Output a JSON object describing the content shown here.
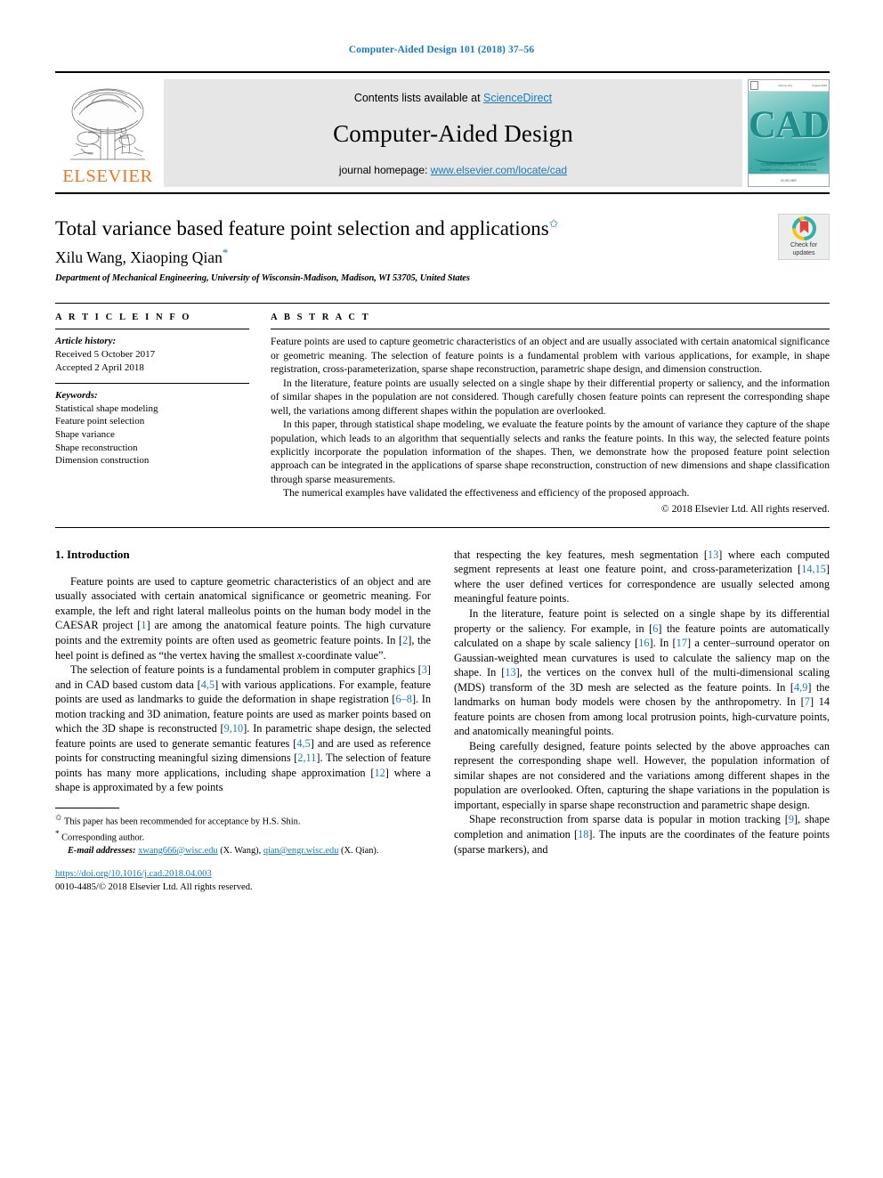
{
  "running_head": "Computer-Aided Design 101 (2018) 37–56",
  "masthead": {
    "publisher_name": "ELSEVIER",
    "contents_prefix": "Contents lists available at ",
    "contents_link": "ScienceDirect",
    "journal_name": "Computer-Aided Design",
    "homepage_prefix": "journal homepage: ",
    "homepage_link": "www.elsevier.com/locate/cad",
    "cover": {
      "letters": "CAD",
      "subtitle": "COMPUTER-AIDED DESIGN",
      "top_left": "Volume 101",
      "top_right": "August 2018",
      "bottom": "ELSEVIER",
      "bottom_note": "Available online at www.sciencedirect.com"
    }
  },
  "article": {
    "title": "Total variance based feature point selection and applications",
    "title_marker": "✩",
    "authors": "Xilu Wang, Xiaoping Qian",
    "author_marker": "*",
    "affiliation": "Department of Mechanical Engineering, University of Wisconsin-Madison, Madison, WI 53705, United States",
    "crossmark_label_line1": "Check for",
    "crossmark_label_line2": "updates"
  },
  "info": {
    "heading": "A R T I C L E   I N F O",
    "history_label": "Article history:",
    "history": [
      "Received 5 October 2017",
      "Accepted 2 April 2018"
    ],
    "keywords_label": "Keywords:",
    "keywords": [
      "Statistical shape modeling",
      "Feature point selection",
      "Shape variance",
      "Shape reconstruction",
      "Dimension construction"
    ]
  },
  "abstract": {
    "heading": "A B S T R A C T",
    "paragraphs": [
      "Feature points are used to capture geometric characteristics of an object and are usually associated with certain anatomical significance or geometric meaning. The selection of feature points is a fundamental problem with various applications, for example, in shape registration, cross-parameterization, sparse shape reconstruction, parametric shape design, and dimension construction.",
      "In the literature, feature points are usually selected on a single shape by their differential property or saliency, and the information of similar shapes in the population are not considered. Though carefully chosen feature points can represent the corresponding shape well, the variations among different shapes within the population are overlooked.",
      "In this paper, through statistical shape modeling, we evaluate the feature points by the amount of variance they capture of the shape population, which leads to an algorithm that sequentially selects and ranks the feature points. In this way, the selected feature points explicitly incorporate the population information of the shapes. Then, we demonstrate how the proposed feature point selection approach can be integrated in the applications of sparse shape reconstruction, construction of new dimensions and shape classification through sparse measurements.",
      "The numerical examples have validated the effectiveness and efficiency of the proposed approach."
    ],
    "copyright": "© 2018 Elsevier Ltd. All rights reserved."
  },
  "body": {
    "section_heading": "1. Introduction",
    "left_column": [
      {
        "indent": true,
        "runs": [
          {
            "t": "Feature points are used to capture geometric characteristics of an object and are usually associated with certain anatomical significance or geometric meaning. For example, the left and right lateral malleolus points on the human body model in the CAESAR project ["
          },
          {
            "t": "1",
            "ref": true
          },
          {
            "t": "] are among the anatomical feature points. The high curvature points and the extremity points are often used as geometric feature points. In ["
          },
          {
            "t": "2",
            "ref": true
          },
          {
            "t": "], the heel point is defined as “the vertex having the smallest "
          },
          {
            "t": "x",
            "ital": true
          },
          {
            "t": "-coordinate value”."
          }
        ]
      },
      {
        "indent": true,
        "runs": [
          {
            "t": "The selection of feature points is a fundamental problem in computer graphics ["
          },
          {
            "t": "3",
            "ref": true
          },
          {
            "t": "] and in CAD based custom data ["
          },
          {
            "t": "4,5",
            "ref": true
          },
          {
            "t": "] with various applications. For example, feature points are used as landmarks to guide the deformation in shape registration ["
          },
          {
            "t": "6–8",
            "ref": true
          },
          {
            "t": "]. In motion tracking and 3D animation, feature points are used as marker points based on which the 3D shape is reconstructed ["
          },
          {
            "t": "9,10",
            "ref": true
          },
          {
            "t": "]. In parametric shape design, the selected feature points are used to generate semantic features ["
          },
          {
            "t": "4,5",
            "ref": true
          },
          {
            "t": "] and are used as reference points for constructing meaningful sizing dimensions ["
          },
          {
            "t": "2,11",
            "ref": true
          },
          {
            "t": "]. The selection of feature points has many more applications, including shape approximation ["
          },
          {
            "t": "12",
            "ref": true
          },
          {
            "t": "] where a shape is approximated by a few points"
          }
        ]
      }
    ],
    "right_column": [
      {
        "indent": false,
        "runs": [
          {
            "t": "that respecting the key features, mesh segmentation ["
          },
          {
            "t": "13",
            "ref": true
          },
          {
            "t": "] where each computed segment represents at least one feature point, and cross-parameterization ["
          },
          {
            "t": "14,15",
            "ref": true
          },
          {
            "t": "] where the user defined vertices for correspondence are usually selected among meaningful feature points."
          }
        ]
      },
      {
        "indent": true,
        "runs": [
          {
            "t": "In the literature, feature point is selected on a single shape by its differential property or the saliency. For example, in ["
          },
          {
            "t": "6",
            "ref": true
          },
          {
            "t": "] the feature points are automatically calculated on a shape by scale saliency ["
          },
          {
            "t": "16",
            "ref": true
          },
          {
            "t": "]. In ["
          },
          {
            "t": "17",
            "ref": true
          },
          {
            "t": "] a center–surround operator on Gaussian-weighted mean curvatures is used to calculate the saliency map on the shape. In ["
          },
          {
            "t": "13",
            "ref": true
          },
          {
            "t": "], the vertices on the convex hull of the multi-dimensional scaling (MDS) transform of the 3D mesh are selected as the feature points. In ["
          },
          {
            "t": "4,9",
            "ref": true
          },
          {
            "t": "] the landmarks on human body models were chosen by the anthropometry. In ["
          },
          {
            "t": "7",
            "ref": true
          },
          {
            "t": "] 14 feature points are chosen from among local protrusion points, high-curvature points, and anatomically meaningful points."
          }
        ]
      },
      {
        "indent": true,
        "runs": [
          {
            "t": "Being carefully designed, feature points selected by the above approaches can represent the corresponding shape well. However, the population information of similar shapes are not considered and the variations among different shapes in the population are overlooked. Often, capturing the shape variations in the population is important, especially in sparse shape reconstruction and parametric shape design."
          }
        ]
      },
      {
        "indent": true,
        "runs": [
          {
            "t": "Shape reconstruction from sparse data is popular in motion tracking ["
          },
          {
            "t": "9",
            "ref": true
          },
          {
            "t": "], shape completion and animation ["
          },
          {
            "t": "18",
            "ref": true
          },
          {
            "t": "]. The inputs are the coordinates of the feature points (sparse markers), and"
          }
        ]
      }
    ]
  },
  "footnotes": {
    "star_symbol": "✩",
    "star_text": "This paper has been recommended for acceptance by H.S. Shin.",
    "asterisk_symbol": "*",
    "asterisk_text": "Corresponding author.",
    "email_label": "E-mail addresses:",
    "email1": "xwang666@wisc.edu",
    "email1_owner": "(X. Wang),",
    "email2": "qian@engr.wisc.edu",
    "email2_owner": "(X. Qian).",
    "doi": "https://doi.org/10.1016/j.cad.2018.04.003",
    "issn_line": "0010-4485/© 2018 Elsevier Ltd. All rights reserved."
  },
  "colors": {
    "link_blue": "#1a7bb9",
    "elsevier_orange": "#e87722",
    "cad_teal": "#1f8e8a"
  }
}
